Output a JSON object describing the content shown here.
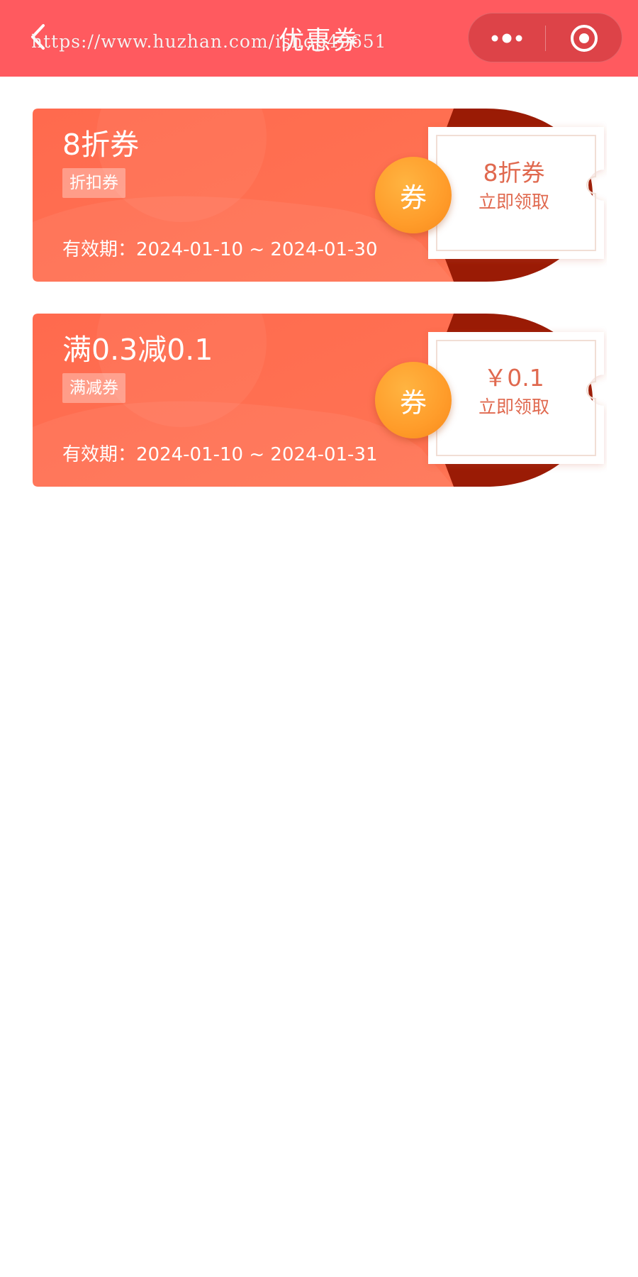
{
  "header": {
    "title": "优惠券",
    "watermark": "https://www.huzhan.com/ishop49651",
    "background_color": "#ff5a5f"
  },
  "icons": {
    "back": "chevron-left-icon",
    "more": "more-dots-icon",
    "close": "target-circle-icon"
  },
  "coupons": [
    {
      "title": "8折券",
      "tag": "折扣券",
      "validity": "有效期：2024-01-10 ~ 2024-01-30",
      "badge": "券",
      "value": "8折券",
      "action": "立即领取"
    },
    {
      "title": "满0.3减0.1",
      "tag": "满减券",
      "validity": "有效期：2024-01-10 ~ 2024-01-31",
      "badge": "券",
      "value": "￥0.1",
      "action": "立即领取"
    }
  ],
  "colors": {
    "card_orange": "#ff6b4f",
    "card_dark_red": "#9a1b05",
    "badge_orange": "#ff9f2a",
    "action_text": "#e0694f"
  }
}
